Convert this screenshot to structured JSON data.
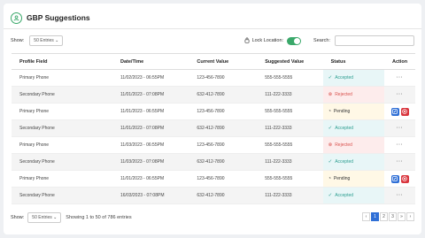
{
  "header": {
    "title": "GBP Suggestions"
  },
  "toolbar": {
    "show_label": "Show:",
    "entries_value": "50 Entries",
    "lock_label": "Lock Location:",
    "search_label": "Search:",
    "search_value": ""
  },
  "table": {
    "columns": [
      "Profile Field",
      "Date/Time",
      "Current Value",
      "Suggested Value",
      "Status",
      "Action"
    ],
    "rows": [
      {
        "field": "Primary Phone",
        "datetime": "11/02/2023 - 06:55PM",
        "current": "123-456-7890",
        "suggested": "555-555-5555",
        "status": "Accepted",
        "action": "dots"
      },
      {
        "field": "Secondary Phone",
        "datetime": "11/01/2023 - 07:08PM",
        "current": "632-412-7890",
        "suggested": "111-222-3333",
        "status": "Rejected",
        "action": "dots"
      },
      {
        "field": "Primary Phone",
        "datetime": "11/01/2023 - 06:55PM",
        "current": "123-456-7890",
        "suggested": "555-555-5555",
        "status": "Pending",
        "action": "buttons"
      },
      {
        "field": "Secondary Phone",
        "datetime": "11/01/2023 - 07:08PM",
        "current": "632-412-7890",
        "suggested": "111-222-3333",
        "status": "Accepted",
        "action": "dots"
      },
      {
        "field": "Primary Phone",
        "datetime": "11/03/2023 - 06:55PM",
        "current": "123-456-7890",
        "suggested": "555-555-5555",
        "status": "Rejected",
        "action": "dots"
      },
      {
        "field": "Secondary Phone",
        "datetime": "11/03/2023 - 07:08PM",
        "current": "632-412-7890",
        "suggested": "111-222-3333",
        "status": "Accepted",
        "action": "dots"
      },
      {
        "field": "Primary Phone",
        "datetime": "11/01/2023 - 06:55PM",
        "current": "123-456-7890",
        "suggested": "555-555-5555",
        "status": "Pending",
        "action": "buttons"
      },
      {
        "field": "Secondary Phone",
        "datetime": "16/03/2023 - 07:08PM",
        "current": "632-412-7890",
        "suggested": "111-222-3333",
        "status": "Accepted",
        "action": "dots"
      }
    ]
  },
  "footer": {
    "show_label": "Show:",
    "entries_value": "50 Entries",
    "info": "Showing 1 to 50 of 786 entries",
    "pages": [
      "‹",
      "1",
      "2",
      "3",
      "»",
      "›"
    ],
    "active_page": "1"
  },
  "colors": {
    "brand": "#3aa86a",
    "primary": "#2f6fd6",
    "danger": "#d9363e"
  }
}
